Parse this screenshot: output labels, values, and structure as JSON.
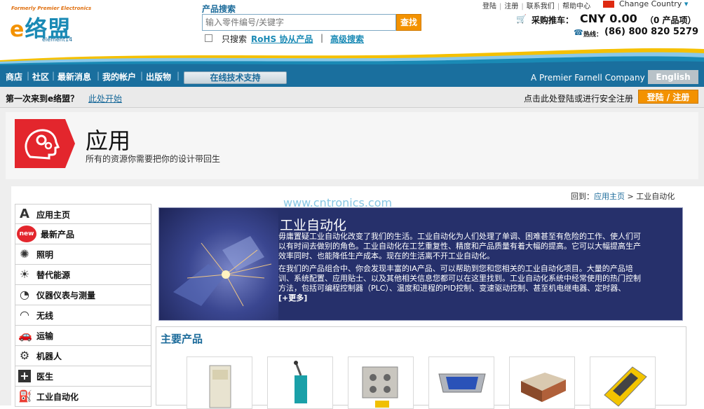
{
  "header": {
    "logo_tagline": "Formerly Premier Electronics",
    "logo_text": "络盟",
    "logo_e": "e",
    "logo_sub": "element14",
    "search_label": "产品搜索",
    "search_placeholder": "输入零件编号/关键字",
    "search_button": "查找",
    "rohs_only": "只搜索",
    "rohs_link": "RoHS 协从产品",
    "rohs_sep": "|",
    "advanced_search": "高级搜索",
    "top_links": [
      "登陆",
      "注册",
      "联系我们",
      "帮助中心"
    ],
    "country_selector": "Change Country",
    "cart_label": "采购推车：",
    "cart_amount": "CNY 0.00",
    "cart_items": "（0 产品项）",
    "phone_label": "热线：",
    "phone_number": "(86) 800 820 5279"
  },
  "nav": {
    "items": [
      "商店",
      "社区",
      "最新消息",
      "我的帐户",
      "出版物"
    ],
    "tech_support": "在线技术支持",
    "company": "A Premier Farnell Company",
    "language": "English"
  },
  "first_bar": {
    "question": "第一次来到e络盟？",
    "start_link": "此处开始",
    "login_prompt": "点击此处登陆或进行安全注册",
    "login_button": "登陆 / 注册"
  },
  "banner": {
    "title": "应用",
    "subtitle": "所有的资源你需要把你的设计带回生"
  },
  "breadcrumb": {
    "prefix": "回到：",
    "home": "应用主页",
    "separator": ">",
    "current": "工业自动化"
  },
  "watermark": "www.cntronics.com",
  "sidebar": {
    "items": [
      {
        "label": "应用主页",
        "icon": "home-letter-a-icon"
      },
      {
        "label": "最新产品",
        "icon": "new-badge-icon"
      },
      {
        "label": "照明",
        "icon": "lighting-icon"
      },
      {
        "label": "替代能源",
        "icon": "sun-icon"
      },
      {
        "label": "仪器仪表与测量",
        "icon": "gauge-icon"
      },
      {
        "label": "无线",
        "icon": "wireless-icon"
      },
      {
        "label": "运输",
        "icon": "car-icon"
      },
      {
        "label": "机器人",
        "icon": "robot-arm-icon"
      },
      {
        "label": "医生",
        "icon": "medical-cross-icon"
      },
      {
        "label": "工业自动化",
        "icon": "fuel-pump-icon"
      }
    ]
  },
  "feature": {
    "title": "工业自动化",
    "p1": "毋庸置疑工业自动化改变了我们的生活。工业自动化为人们处理了单调、困难甚至有危险的工作、使人们可以有时间去做别的角色。工业自动化在工艺重复性、精度和产品质量有着大幅的提高。它可以大幅提高生产效率同时、也能降低生产成本。现在的生活离不开工业自动化。",
    "p2": "在我们的产品组合中、你会发现丰富的IA产品、可以帮助到您和您相关的工业自动化项目。大量的产品培训、系统配置、应用贴士、以及其他相关信息您都可以在这里找到。工业自动化系统中经常使用的热门控制方法，包括可编程控制器（PLC）、温度和进程的PID控制、变速驱动控制、甚至机电继电器、定时器、",
    "more": "[+更多]"
  },
  "products": {
    "title": "主要产品"
  },
  "colors": {
    "brand_blue": "#1a6f9e",
    "accent_orange": "#f39200",
    "feature_bg": "#26306b"
  }
}
